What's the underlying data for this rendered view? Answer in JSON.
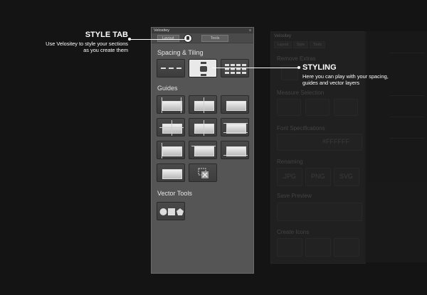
{
  "panel": {
    "title": "Velositey",
    "menu": "≡",
    "tabs": [
      "Layout",
      "Tools"
    ],
    "sections": {
      "spacing": "Spacing & Tiling",
      "guides": "Guides",
      "vector": "Vector Tools"
    }
  },
  "annotations": {
    "style_tab": {
      "title": "STYLE TAB",
      "line1": "Use Velositey to style your sections",
      "line2": "as you create them"
    },
    "styling": {
      "title": "STYLING",
      "line1": "Here you can play with your spacing,",
      "line2": "guides and vector layers"
    }
  },
  "ghost_panel": {
    "title": "Velositey",
    "tabs": [
      "Layout",
      "Style",
      "Tools"
    ],
    "sections": [
      "Remove Extras",
      "Measure Selection",
      "Font Specifications",
      "Renaming",
      "Save Preview",
      "Create Icons"
    ],
    "color_value": "#FFFFFF",
    "renaming": [
      ".JPG",
      "PNG",
      "SVG"
    ]
  },
  "colors": {
    "accent": "#ffffff",
    "panel": "#555555",
    "background": "#141414"
  }
}
